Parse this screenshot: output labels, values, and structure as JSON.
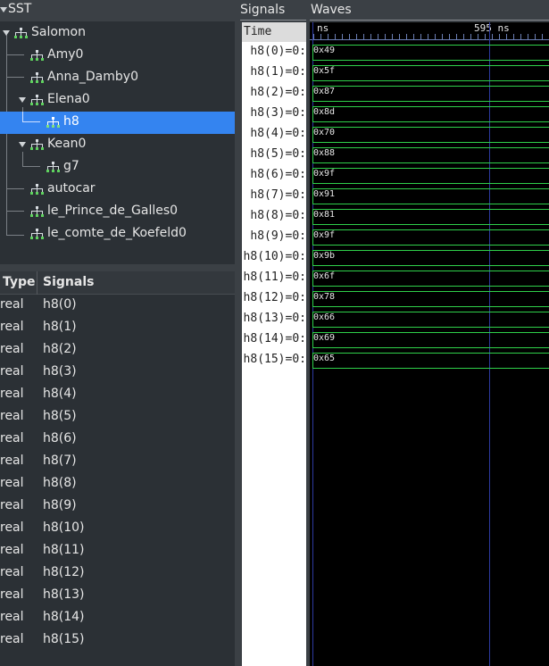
{
  "sst": {
    "title": "SST",
    "tree": [
      {
        "label": "Salomon"
      },
      {
        "label": "Amy0"
      },
      {
        "label": "Anna_Damby0"
      },
      {
        "label": "Elena0"
      },
      {
        "label": "h8"
      },
      {
        "label": "Kean0"
      },
      {
        "label": "g7"
      },
      {
        "label": "autocar"
      },
      {
        "label": "le_Prince_de_Galles0"
      },
      {
        "label": "le_comte_de_Koefeld0"
      }
    ]
  },
  "signal_list": {
    "col_type": "Type",
    "col_signals": "Signals",
    "rows": [
      {
        "type": "real",
        "name": "h8(0)"
      },
      {
        "type": "real",
        "name": "h8(1)"
      },
      {
        "type": "real",
        "name": "h8(2)"
      },
      {
        "type": "real",
        "name": "h8(3)"
      },
      {
        "type": "real",
        "name": "h8(4)"
      },
      {
        "type": "real",
        "name": "h8(5)"
      },
      {
        "type": "real",
        "name": "h8(6)"
      },
      {
        "type": "real",
        "name": "h8(7)"
      },
      {
        "type": "real",
        "name": "h8(8)"
      },
      {
        "type": "real",
        "name": "h8(9)"
      },
      {
        "type": "real",
        "name": "h8(10)"
      },
      {
        "type": "real",
        "name": "h8(11)"
      },
      {
        "type": "real",
        "name": "h8(12)"
      },
      {
        "type": "real",
        "name": "h8(13)"
      },
      {
        "type": "real",
        "name": "h8(14)"
      },
      {
        "type": "real",
        "name": "h8(15)"
      }
    ]
  },
  "signals_panel": {
    "title": "Signals",
    "time_label": "Time",
    "names": [
      "h8(0)=0:",
      "h8(1)=0:",
      "h8(2)=0:",
      "h8(3)=0:",
      "h8(4)=0:",
      "h8(5)=0:",
      "h8(6)=0:",
      "h8(7)=0:",
      "h8(8)=0:",
      "h8(9)=0:",
      "h8(10)=0:",
      "h8(11)=0:",
      "h8(12)=0:",
      "h8(13)=0:",
      "h8(14)=0:",
      "h8(15)=0:"
    ]
  },
  "waves_panel": {
    "title": "Waves",
    "ruler_unit": "ns",
    "ruler_marker": "595 ns",
    "values": [
      "0x49",
      "0x5f",
      "0x87",
      "0x8d",
      "0x70",
      "0x88",
      "0x9f",
      "0x91",
      "0x81",
      "0x9f",
      "0x9b",
      "0x6f",
      "0x78",
      "0x66",
      "0x69",
      "0x65"
    ]
  },
  "colors": {
    "selection": "#3484f0",
    "wave": "#2fd04a",
    "marker_line": "#2d3aa0"
  }
}
